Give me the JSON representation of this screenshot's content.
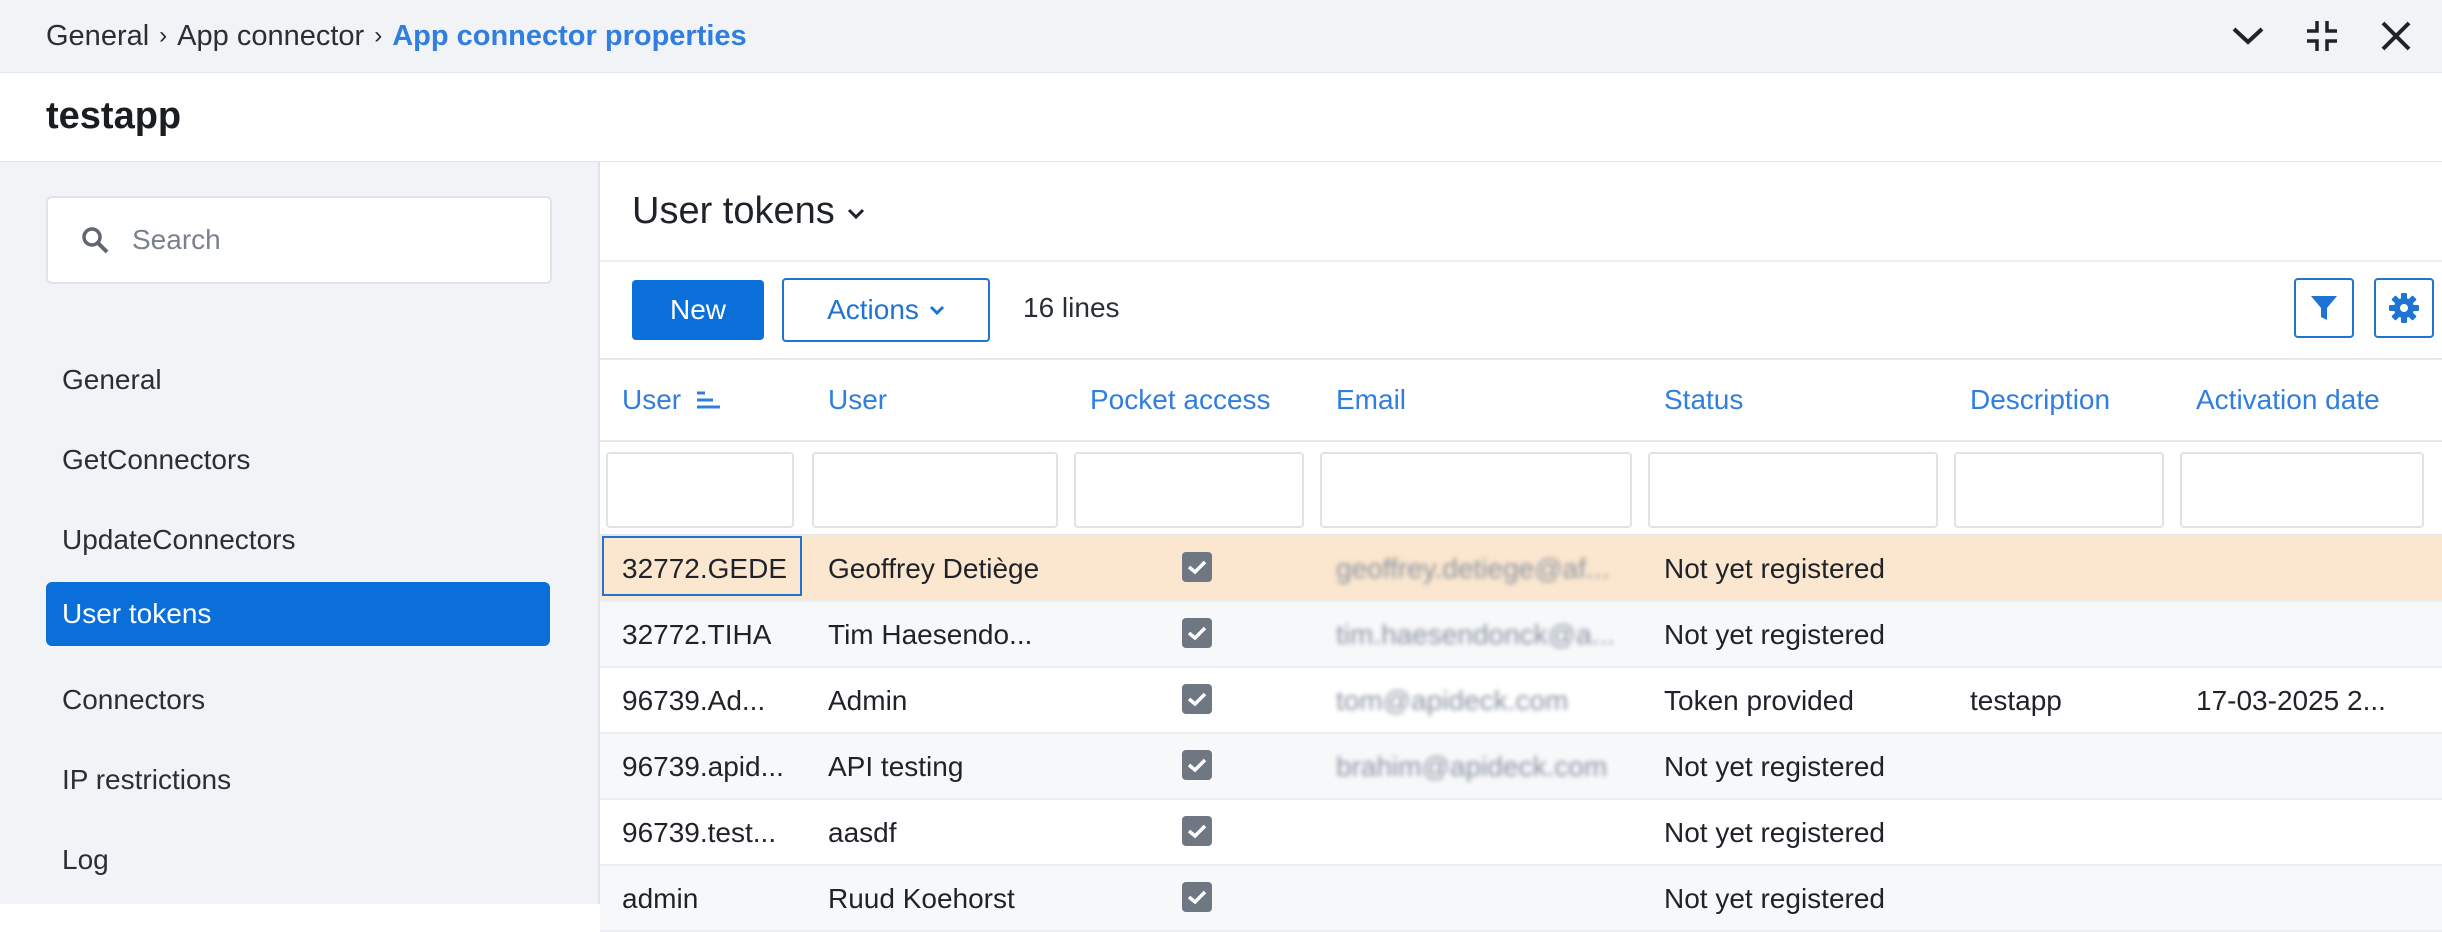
{
  "breadcrumb": [
    "General",
    "App connector",
    "App connector properties"
  ],
  "window_controls": [
    "chevron-down-icon",
    "collapse-icon",
    "close-icon"
  ],
  "page_title": "testapp",
  "search": {
    "placeholder": "Search",
    "value": ""
  },
  "sidebar": {
    "items": [
      {
        "label": "General"
      },
      {
        "label": "GetConnectors"
      },
      {
        "label": "UpdateConnectors"
      },
      {
        "label": "User tokens",
        "selected": true
      },
      {
        "label": "Connectors"
      },
      {
        "label": "IP restrictions"
      },
      {
        "label": "Log"
      }
    ]
  },
  "section": {
    "title": "User tokens"
  },
  "toolbar": {
    "new_label": "New",
    "actions_label": "Actions",
    "line_count": "16 lines"
  },
  "table": {
    "columns": [
      "User",
      "User",
      "Pocket access",
      "Email",
      "Status",
      "Description",
      "Activation date"
    ],
    "sort_column": 0,
    "rows": [
      {
        "user_id": "32772.GEDE",
        "user": "Geoffrey Detiège",
        "pocket_access": true,
        "email": "geoffrey.detiege@af...",
        "status": "Not yet registered",
        "description": "",
        "activation": ""
      },
      {
        "user_id": "32772.TIHA",
        "user": "Tim Haesendo...",
        "pocket_access": true,
        "email": "tim.haesendonck@a...",
        "status": "Not yet registered",
        "description": "",
        "activation": ""
      },
      {
        "user_id": "96739.Ad...",
        "user": "Admin",
        "pocket_access": true,
        "email": "tom@apideck.com",
        "status": "Token provided",
        "description": "testapp",
        "activation": "17-03-2025 2..."
      },
      {
        "user_id": "96739.apid...",
        "user": "API testing",
        "pocket_access": true,
        "email": "brahim@apideck.com",
        "status": "Not yet registered",
        "description": "",
        "activation": ""
      },
      {
        "user_id": "96739.test...",
        "user": "aasdf",
        "pocket_access": true,
        "email": "",
        "status": "Not yet registered",
        "description": "",
        "activation": ""
      },
      {
        "user_id": "admin",
        "user": "Ruud Koehorst",
        "pocket_access": true,
        "email": "",
        "status": "Not yet registered",
        "description": "",
        "activation": ""
      }
    ]
  },
  "colors": {
    "accent": "#0a6fd8",
    "link": "#2f7ee0",
    "selected_row": "#fbe6cf"
  }
}
